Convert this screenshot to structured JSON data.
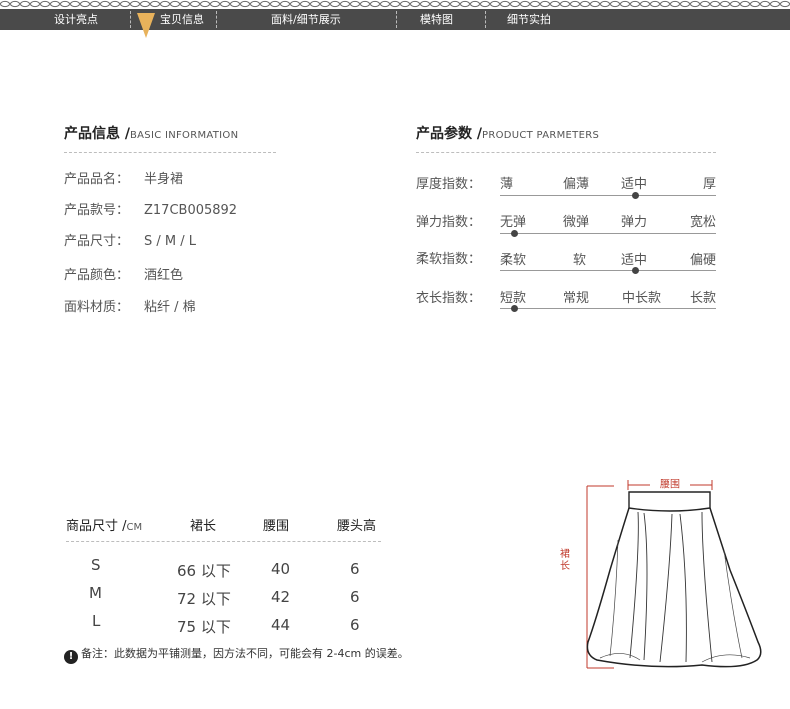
{
  "nav": {
    "tabs": [
      {
        "label": "设计亮点"
      },
      {
        "label": "宝贝信息"
      },
      {
        "label": "面料/细节展示"
      },
      {
        "label": "模特图"
      },
      {
        "label": "细节实拍"
      }
    ],
    "active_index": 1,
    "colors": {
      "bar": "#4a4a4a",
      "pointer": "#e8b25b"
    }
  },
  "product_info": {
    "title": "产品信息 /",
    "subtitle": "BASIC INFORMATION",
    "rows": [
      {
        "label": "产品品名：",
        "value": "半身裙"
      },
      {
        "label": "产品款号：",
        "value": "Z17CB005892"
      },
      {
        "label": "产品尺寸：",
        "value": "S / M / L"
      },
      {
        "label": "产品颜色：",
        "value": "酒红色"
      },
      {
        "label": "面料材质：",
        "value": "粘纤 / 棉"
      }
    ]
  },
  "product_params": {
    "title": "产品参数 /",
    "subtitle": "PRODUCT PARMETERS",
    "rows": [
      {
        "label": "厚度指数：",
        "options": [
          "薄",
          "偏薄",
          "适中",
          "厚"
        ],
        "selected": 2
      },
      {
        "label": "弹力指数：",
        "options": [
          "无弹",
          "微弹",
          "弹力",
          "宽松"
        ],
        "selected": 0
      },
      {
        "label": "柔软指数：",
        "options": [
          "柔软",
          "软",
          "适中",
          "偏硬"
        ],
        "selected": 2
      },
      {
        "label": "衣长指数：",
        "options": [
          "短款",
          "常规",
          "中长款",
          "长款"
        ],
        "selected": 0
      }
    ]
  },
  "size_table": {
    "title": "商品尺寸 /",
    "unit": "CM",
    "headers": [
      "裙长",
      "腰围",
      "腰头高"
    ],
    "rows": [
      {
        "size": "S",
        "length": "66 以下",
        "waist": "40",
        "waistband": "6"
      },
      {
        "size": "M",
        "length": "72 以下",
        "waist": "42",
        "waistband": "6"
      },
      {
        "size": "L",
        "length": "75 以下",
        "waist": "44",
        "waistband": "6"
      }
    ],
    "note_icon": "!",
    "note": "备注：此数据为平铺测量，因方法不同，可能会有 2-4cm 的误差。"
  },
  "diagram": {
    "waist_label": "腰围",
    "length_label": "裙长",
    "label_color": "#c0392b"
  }
}
